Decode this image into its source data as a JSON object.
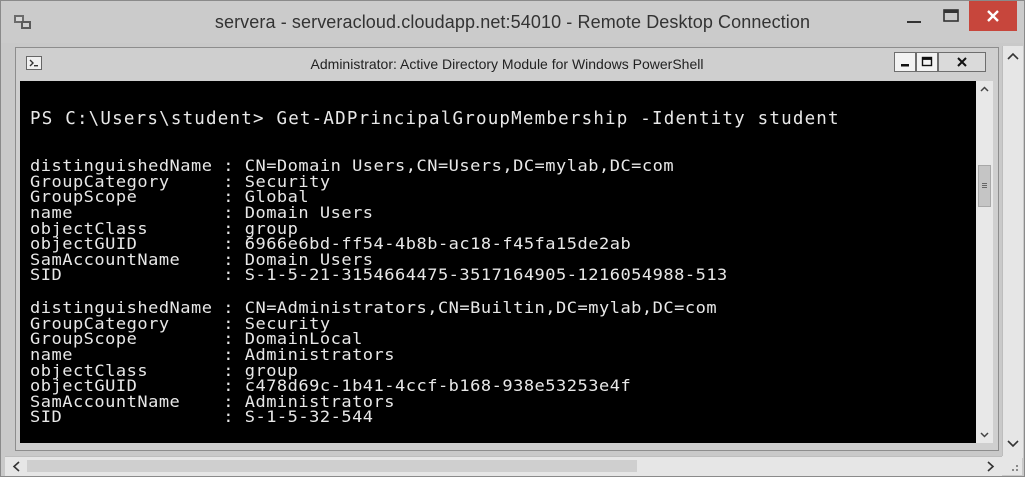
{
  "rdp_window": {
    "title": "servera - serveracloud.cloudapp.net:54010 - Remote Desktop Connection"
  },
  "ps_window": {
    "title": "Administrator: Active Directory Module for Windows PowerShell"
  },
  "console": {
    "prompt": "PS C:\\Users\\student> Get-ADPrincipalGroupMembership -Identity student",
    "records": [
      {
        "fields": [
          {
            "key": "distinguishedName",
            "value": "CN=Domain Users,CN=Users,DC=mylab,DC=com"
          },
          {
            "key": "GroupCategory",
            "value": "Security"
          },
          {
            "key": "GroupScope",
            "value": "Global"
          },
          {
            "key": "name",
            "value": "Domain Users"
          },
          {
            "key": "objectClass",
            "value": "group"
          },
          {
            "key": "objectGUID",
            "value": "6966e6bd-ff54-4b8b-ac18-f45fa15de2ab"
          },
          {
            "key": "SamAccountName",
            "value": "Domain Users"
          },
          {
            "key": "SID",
            "value": "S-1-5-21-3154664475-3517164905-1216054988-513"
          }
        ]
      },
      {
        "fields": [
          {
            "key": "distinguishedName",
            "value": "CN=Administrators,CN=Builtin,DC=mylab,DC=com"
          },
          {
            "key": "GroupCategory",
            "value": "Security"
          },
          {
            "key": "GroupScope",
            "value": "DomainLocal"
          },
          {
            "key": "name",
            "value": "Administrators"
          },
          {
            "key": "objectClass",
            "value": "group"
          },
          {
            "key": "objectGUID",
            "value": "c478d69c-1b41-4ccf-b168-938e53253e4f"
          },
          {
            "key": "SamAccountName",
            "value": "Administrators"
          },
          {
            "key": "SID",
            "value": "S-1-5-32-544"
          }
        ]
      }
    ]
  },
  "icons": {
    "rdp_app": "remote-desktop-icon",
    "ps_app": "powershell-icon",
    "minimize": "minimize-icon",
    "maximize": "maximize-icon",
    "close": "close-icon",
    "scroll_up": "chevron-up-icon",
    "scroll_down": "chevron-down-icon",
    "scroll_left": "chevron-left-icon",
    "scroll_right": "chevron-right-icon"
  },
  "colors": {
    "console_bg": "#000000",
    "console_fg": "#e8e8e8",
    "close_red": "#c7463c"
  }
}
